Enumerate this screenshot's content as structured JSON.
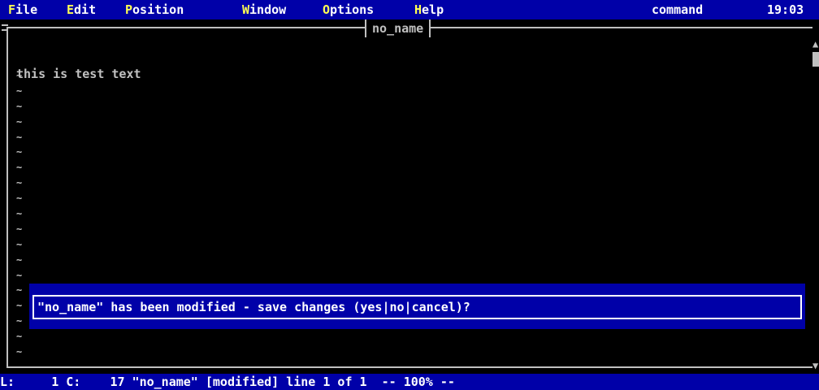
{
  "menubar": {
    "items": [
      {
        "hotkey": "F",
        "rest": "ile"
      },
      {
        "hotkey": "E",
        "rest": "dit"
      },
      {
        "hotkey": "P",
        "rest": "osition"
      },
      {
        "hotkey": "W",
        "rest": "indow"
      },
      {
        "hotkey": "O",
        "rest": "ptions"
      },
      {
        "hotkey": "H",
        "rest": "elp"
      }
    ],
    "mode": "command",
    "clock": "19:03"
  },
  "editor": {
    "tab_title": "no_name",
    "first_line": "this is test text",
    "tilde": "~"
  },
  "prompt": {
    "message": "\"no_name\" has been modified - save changes (yes|no|cancel)?"
  },
  "statusbar": {
    "text": "L:     1 C:    17 \"no_name\" [modified] line 1 of 1  -- 100% --"
  },
  "colors": {
    "menu_bg": "#0000a8",
    "hotkey": "#ffff54",
    "text": "#c0c0c0"
  }
}
